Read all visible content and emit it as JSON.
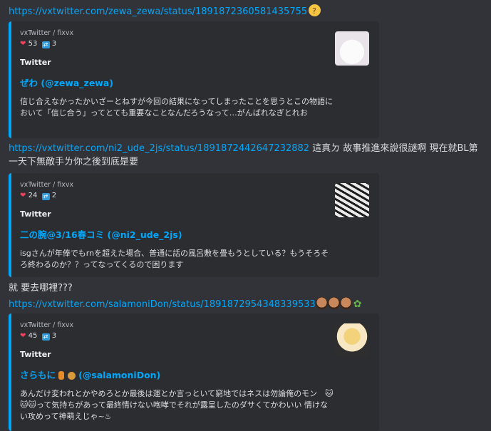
{
  "messages": [
    {
      "link": "https://vxtwitter.com/zewa_zewa/status/1891872360581435755",
      "emoji": "thinking-face"
    },
    {
      "link": "https://vxtwitter.com/ni2_ude_2js/status/1891872442647232882",
      "text": " 這真ㄉ 故事推進來說很謎啊 現在就BL第一天下無敵手ㄌ你之後到底是要"
    },
    {
      "text": "就 要去哪裡???"
    },
    {
      "link": "https://vxtwitter.com/salamoniDon/status/1891872954348339533",
      "emoji": "face-emojis-sprout"
    }
  ],
  "embeds": [
    {
      "provider": "vxTwitter / fixvx",
      "likes": "53",
      "retweets": "3",
      "title": "Twitter",
      "author": "ぜわ (@zewa_zewa)",
      "body": "信じ合えなかったかいざーとねすが今回の結果になってしまったことを思うとこの物語において「信じ合う」ってとても重要なことなんだろうなって…がんばれなぎとれお"
    },
    {
      "provider": "vxTwitter / fixvx",
      "likes": "24",
      "retweets": "2",
      "title": "Twitter",
      "author": "二の腕@3/16春コミ (@ni2_ude_2js)",
      "body": "isgさんが年俸でもrnを超えた場合、普通に話の風呂敷を畳もうとしている？もうそろそろ終わるのか？？ってなってくるので困ります"
    },
    {
      "provider": "vxTwitter / fixvx",
      "likes": "45",
      "retweets": "3",
      "title": "Twitter",
      "author_prefix": "さらもに",
      "author": "(@salamoniDon)",
      "body": "あんだけ変われとかやめろとか最後は運とか言っといて窮地ではネスは勿論俺のモン　🐱🐱🐱って気持ちがあって最終情けない咆哮でそれが露呈したのダサくてかわいい 情けない攻めって神萌えじゃ~♨"
    }
  ],
  "colors": {
    "link": "#00a8fc",
    "background": "#313338",
    "embed_bg": "#2b2d31"
  }
}
